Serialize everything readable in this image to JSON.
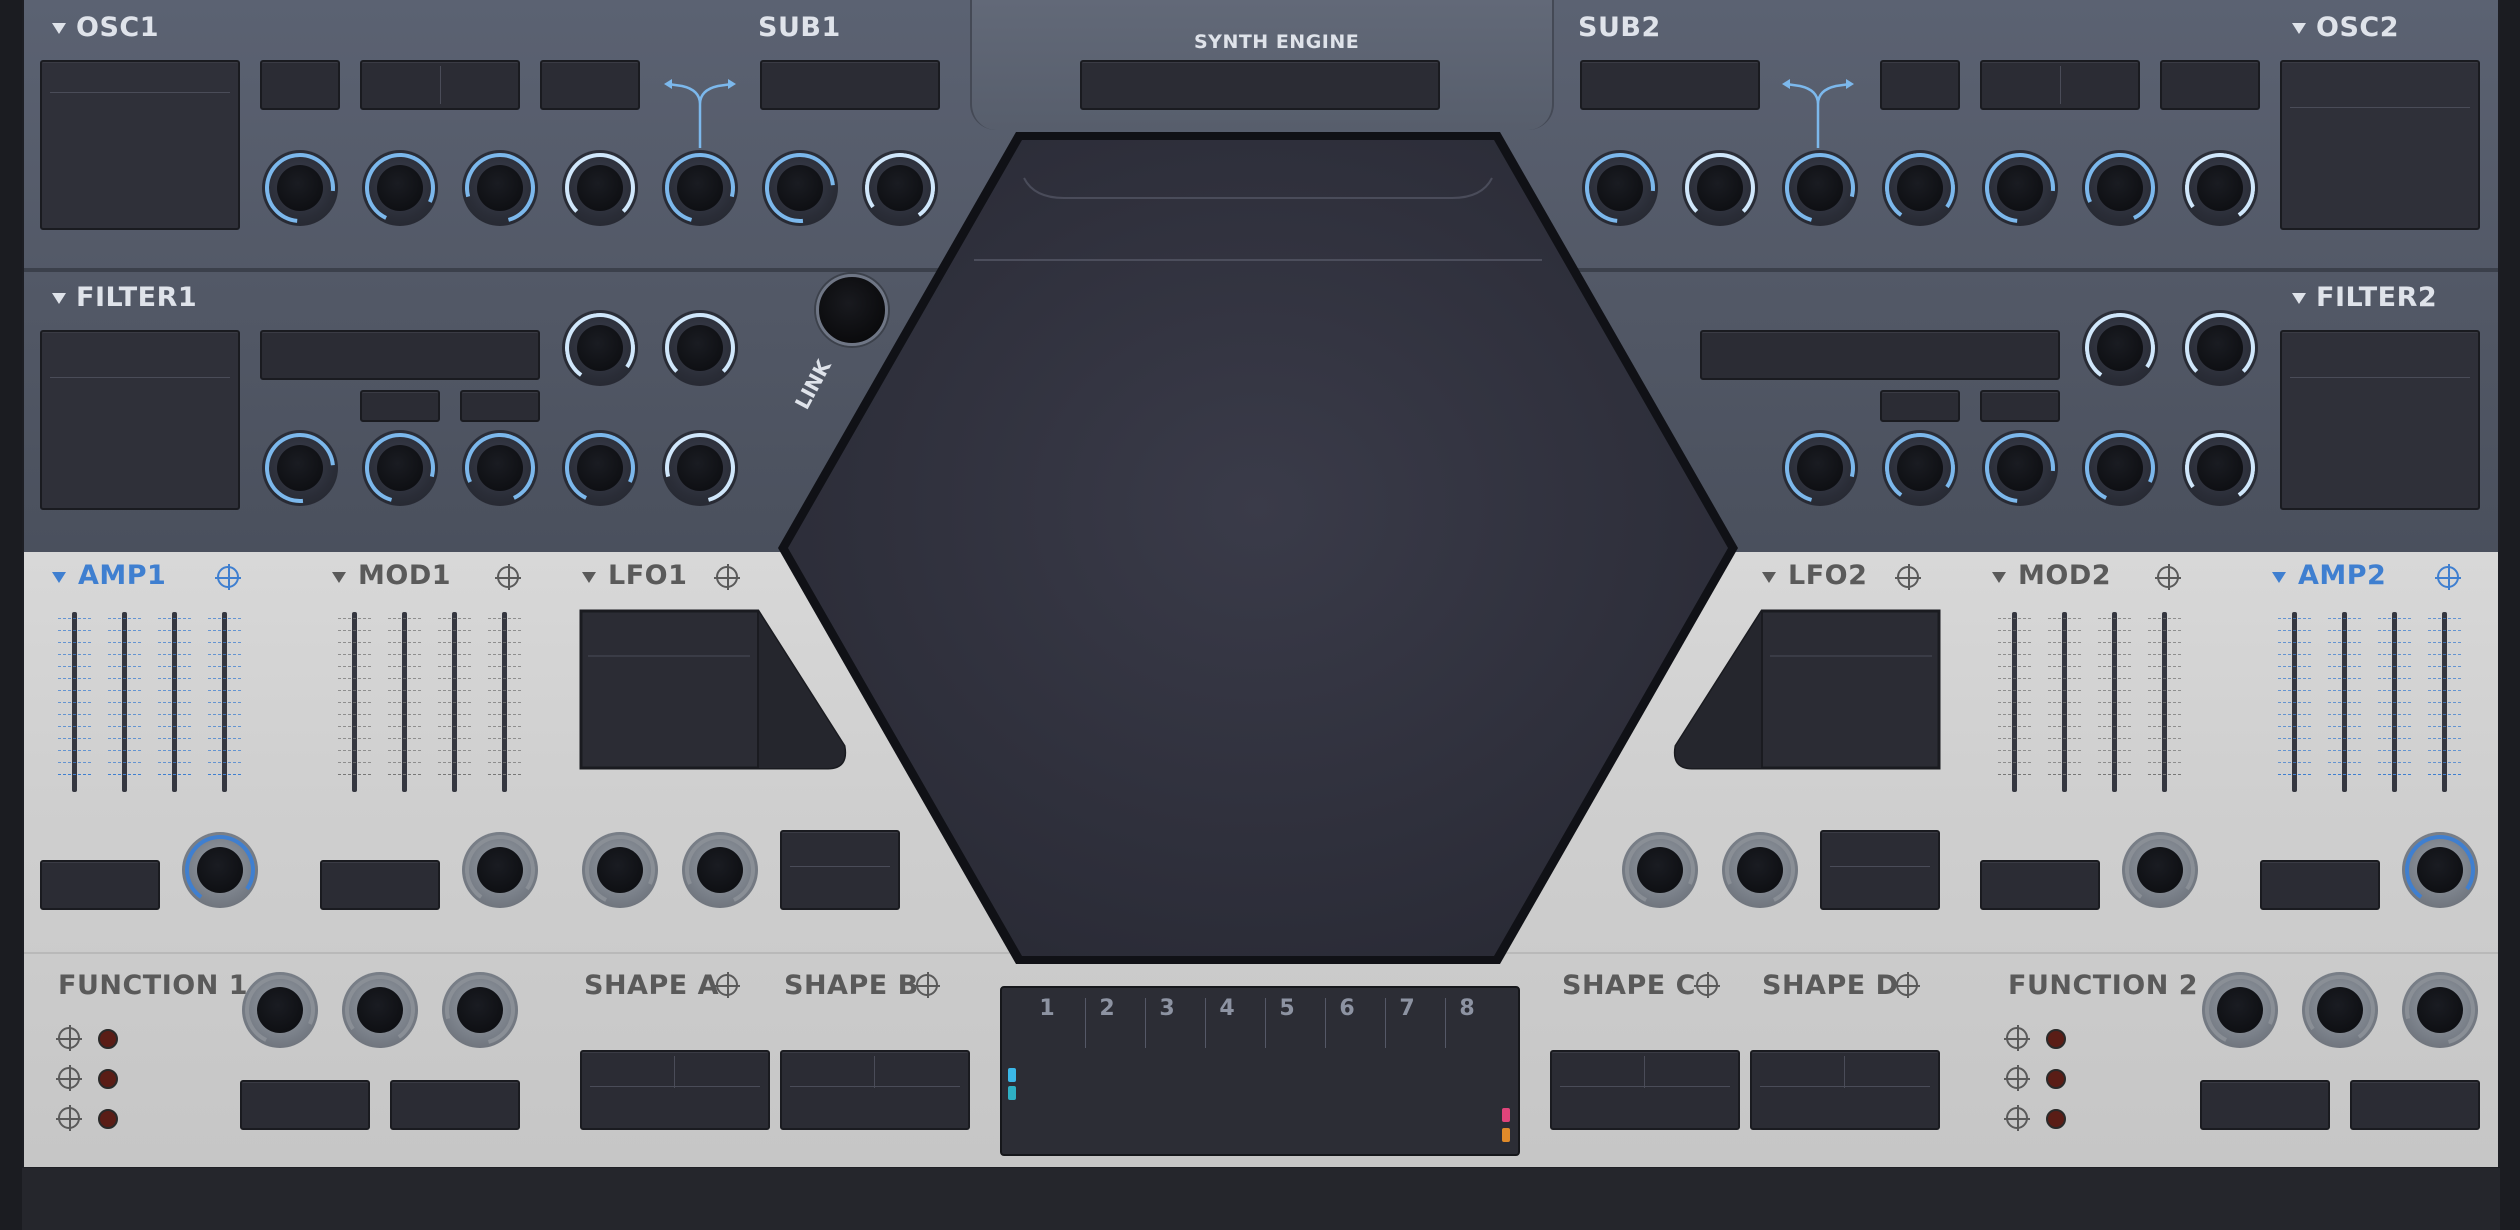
{
  "sections": {
    "osc1": "OSC1",
    "sub1": "SUB1",
    "synth_engine": "SYNTH ENGINE",
    "sub2": "SUB2",
    "osc2": "OSC2",
    "filter1": "FILTER1",
    "filter2": "FILTER2",
    "link": "LINK",
    "amp1": "AMP1",
    "mod1": "MOD1",
    "lfo1": "LFO1",
    "lfo2": "LFO2",
    "mod2": "MOD2",
    "amp2": "AMP2",
    "function1": "FUNCTION 1",
    "shape_a": "SHAPE A",
    "shape_b": "SHAPE B",
    "shape_c": "SHAPE C",
    "shape_d": "SHAPE D",
    "function2": "FUNCTION 2"
  },
  "sequencer": {
    "steps": [
      "1",
      "2",
      "3",
      "4",
      "5",
      "6",
      "7",
      "8"
    ]
  },
  "colors": {
    "accent_blue": "#7cb8ec",
    "amp_title_blue": "#3f7fd0",
    "panel_dark": "#555b69",
    "panel_light": "#d2d2d2",
    "display_bg": "#2b2c34",
    "marker_cyan": "#3bb8e8",
    "marker_pink": "#e0447a",
    "marker_orange": "#e08a2a"
  }
}
